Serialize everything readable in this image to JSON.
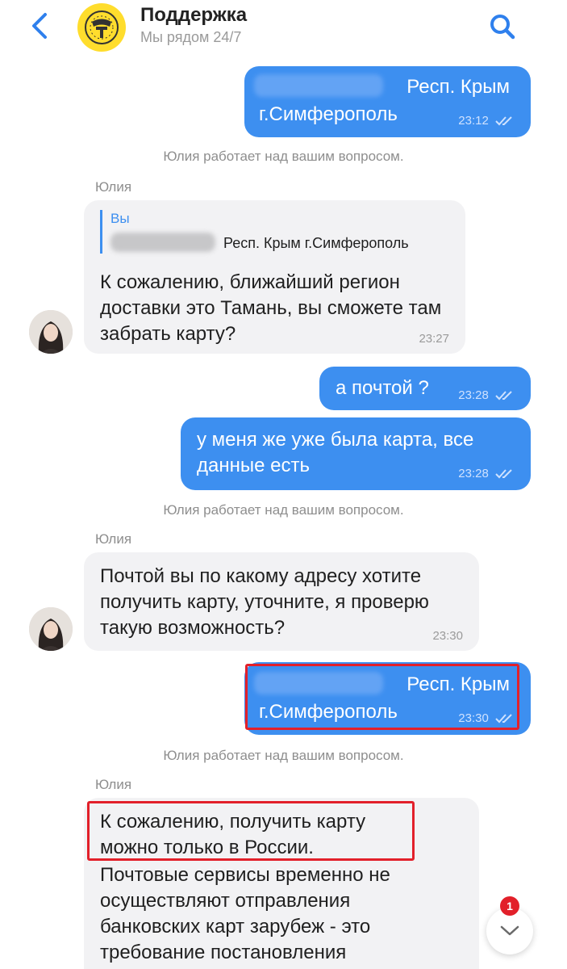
{
  "header": {
    "title": "Поддержка",
    "subtitle": "Мы рядом 24/7"
  },
  "colors": {
    "accent": "#3d8ff0",
    "outgoing_bubble": "#3d8ff0",
    "incoming_bubble": "#f2f2f4",
    "highlight_box": "#e2202a",
    "logo": "#ffdd2d"
  },
  "messages": [
    {
      "direction": "out",
      "line1": "Респ. Крым",
      "line2": "г.Симферополь",
      "time": "23:12"
    },
    {
      "system": "Юлия работает над вашим вопросом."
    },
    {
      "sender": "Юлия"
    },
    {
      "direction": "in",
      "quote_author": "Вы",
      "quote_text": "Респ. Крым г.Симферополь",
      "text": "К сожалению, ближайший регион доставки это Тамань, вы сможете там забрать карту?",
      "time": "23:27"
    },
    {
      "direction": "out",
      "text": "а почтой ?",
      "time": "23:28"
    },
    {
      "direction": "out",
      "text": "у меня же уже была карта, все данные есть",
      "time": "23:28"
    },
    {
      "system": "Юлия работает над вашим вопросом."
    },
    {
      "sender": "Юлия"
    },
    {
      "direction": "in",
      "text": "Почтой вы по какому адресу хотите получить карту, уточните, я проверю такую возможность?",
      "time": "23:30"
    },
    {
      "direction": "out",
      "line1": "Респ. Крым",
      "line2": "г.Симферополь",
      "time": "23:30"
    },
    {
      "system": "Юлия работает над вашим вопросом."
    },
    {
      "sender": "Юлия"
    },
    {
      "direction": "in",
      "text_highlight": "К сожалению, получить карту можно только в России.",
      "text": "Почтовые сервисы временно не осуществляют отправления банковских карт зарубеж - это требование постановления"
    }
  ],
  "scroll_button": {
    "unread_count": "1"
  },
  "icons": [
    "back-chevron-icon",
    "tinkoff-logo-icon",
    "search-icon",
    "double-check-icon",
    "chevron-down-icon"
  ]
}
